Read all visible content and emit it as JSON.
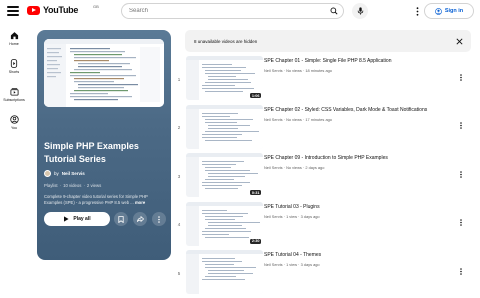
{
  "header": {
    "logo_text": "YouTube",
    "logo_country": "GB",
    "search_placeholder": "Search",
    "sign_in_label": "Sign in"
  },
  "rail": {
    "items": [
      {
        "label": "Home",
        "icon": "home-icon"
      },
      {
        "label": "Shorts",
        "icon": "shorts-icon"
      },
      {
        "label": "Subscriptions",
        "icon": "subscriptions-icon"
      },
      {
        "label": "You",
        "icon": "you-icon"
      }
    ]
  },
  "playlist": {
    "title": "Simple PHP Examples Tutorial Series",
    "by": "by",
    "owner": "Neil Servis",
    "stats": [
      "Playlist",
      "10 videos",
      "2 views"
    ],
    "description": "Complete 9-chapter video tutorial series for Simple PHP Examples (SPE) - a progressive PHP 8.5 web ...",
    "description_more": "more",
    "play_all_label": "Play all"
  },
  "notice": {
    "text": "8 unavailable videos are hidden"
  },
  "videos": [
    {
      "index": "1",
      "title": "SPE Chapter 01 - Simple: Single File PHP 8.5 Application",
      "channel": "Neil Servis",
      "views": "No views",
      "age": "18 minutes ago",
      "duration": "1:06"
    },
    {
      "index": "2",
      "title": "SPE Chapter 02 - Styled: CSS Variables, Dark Mode & Toast Notifications",
      "channel": "Neil Servis",
      "views": "No views",
      "age": "17 minutes ago",
      "duration": ""
    },
    {
      "index": "3",
      "title": "SPE Chapter 09 - Introduction to Simple PHP Examples",
      "channel": "Neil Servis",
      "views": "No views",
      "age": "2 days ago",
      "duration": "0:31"
    },
    {
      "index": "4",
      "title": "SPE Tutorial 03 - Plugins",
      "channel": "Neil Servis",
      "views": "1 view",
      "age": "3 days ago",
      "duration": "2:30"
    },
    {
      "index": "5",
      "title": "SPE Tutorial 04 - Themes",
      "channel": "Neil Servis",
      "views": "1 view",
      "age": "3 days ago",
      "duration": ""
    }
  ],
  "colors": {
    "brand_red": "#ff0000",
    "link_blue": "#065fd4",
    "hero_bg": "#4c6a86"
  }
}
